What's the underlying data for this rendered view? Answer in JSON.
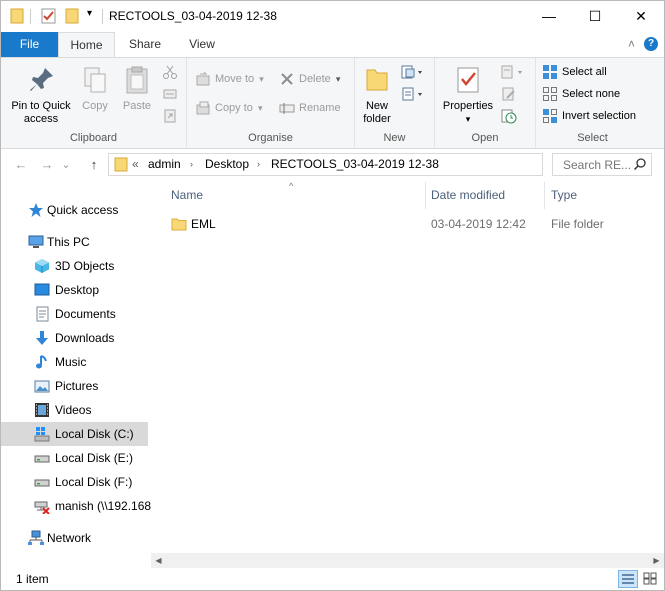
{
  "window": {
    "title": "RECTOOLS_03-04-2019 12-38",
    "minimize_glyph": "—",
    "maximize_glyph": "☐",
    "close_glyph": "✕",
    "quick_access_dropdown_glyph": "▾"
  },
  "tabs": {
    "file": "File",
    "home": "Home",
    "share": "Share",
    "view": "View",
    "collapse_glyph": "˄",
    "help_glyph": "?"
  },
  "ribbon": {
    "clipboard": {
      "label": "Clipboard",
      "pin_line1": "Pin to Quick",
      "pin_line2": "access",
      "copy": "Copy",
      "paste": "Paste"
    },
    "organise": {
      "label": "Organise",
      "move_to": "Move to",
      "copy_to": "Copy to",
      "delete": "Delete",
      "rename": "Rename",
      "dropdown_glyph": "▾"
    },
    "new": {
      "label": "New",
      "new_folder_line1": "New",
      "new_folder_line2": "folder"
    },
    "open": {
      "label": "Open",
      "properties": "Properties",
      "dropdown_glyph": "▾"
    },
    "select": {
      "label": "Select",
      "select_all": "Select all",
      "select_none": "Select none",
      "invert_selection": "Invert selection"
    }
  },
  "address": {
    "back_glyph": "←",
    "forward_glyph": "→",
    "recent_glyph": "⌄",
    "up_glyph": "↑",
    "overflow_glyph": "«",
    "crumb_chevron": "›",
    "dropdown_glyph": "⌄",
    "refresh_glyph": "↻",
    "breadcrumbs": [
      "admin",
      "Desktop",
      "RECTOOLS_03-04-2019 12-38"
    ],
    "search_placeholder": "Search RE..."
  },
  "nav_pane": {
    "items": [
      {
        "label": "Quick access",
        "icon": "star-icon"
      },
      {
        "label": "This PC",
        "icon": "computer-icon"
      },
      {
        "label": "3D Objects",
        "icon": "cube-icon"
      },
      {
        "label": "Desktop",
        "icon": "desktop-icon"
      },
      {
        "label": "Documents",
        "icon": "documents-icon"
      },
      {
        "label": "Downloads",
        "icon": "download-arrow-icon"
      },
      {
        "label": "Music",
        "icon": "music-note-icon"
      },
      {
        "label": "Pictures",
        "icon": "pictures-icon"
      },
      {
        "label": "Videos",
        "icon": "film-icon"
      },
      {
        "label": "Local Disk (C:)",
        "icon": "windows-drive-icon"
      },
      {
        "label": "Local Disk (E:)",
        "icon": "drive-icon"
      },
      {
        "label": "Local Disk (F:)",
        "icon": "drive-icon"
      },
      {
        "label": "manish (\\\\192.168",
        "icon": "disconnected-network-drive-icon"
      },
      {
        "label": "Network",
        "icon": "network-icon"
      }
    ]
  },
  "file_list": {
    "columns": {
      "name": "Name",
      "date_modified": "Date modified",
      "type": "Type",
      "sort_glyph": "^"
    },
    "rows": [
      {
        "name": "EML",
        "date_modified": "03-04-2019 12:42",
        "type": "File folder",
        "icon": "folder-icon"
      }
    ],
    "scroll_left_glyph": "◀",
    "scroll_right_glyph": "▶"
  },
  "status": {
    "item_count": "1 item"
  },
  "colors": {
    "file_tab": "#1979ca",
    "ribbon_bg": "#f5f6f7",
    "selected_nav": "#d9d9d9",
    "column_header_text": "#4c607a",
    "folder_yellow": "#f8d775"
  }
}
